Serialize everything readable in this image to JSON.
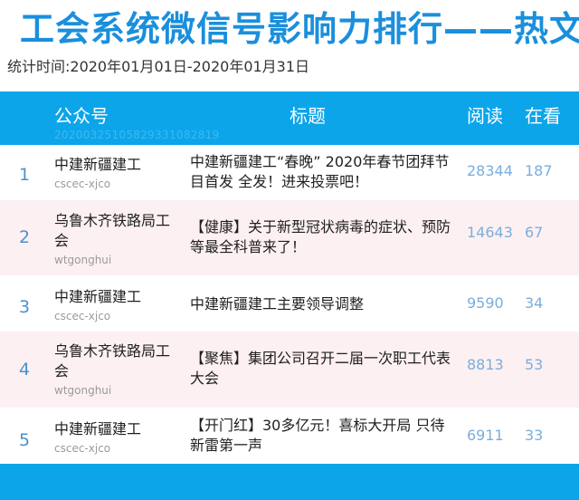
{
  "title": "工会系统微信号影响力排行——热文",
  "period": "统计时间:2020年01月01日-2020年01月31日",
  "table": {
    "headers": {
      "account": "公众号",
      "headline": "标题",
      "reads": "阅读",
      "watching": "在看"
    },
    "header_code": "20200325105829331082819",
    "rows": [
      {
        "rank": "1",
        "account": "中建新疆建工",
        "account_id": "cscec-xjco",
        "headline": "中建新疆建工“春晚” 2020年春节团拜节目首发 全发！进来投票吧！",
        "reads": "28344",
        "watching": "187"
      },
      {
        "rank": "2",
        "account": "乌鲁木齐铁路局工会",
        "account_id": "wtgonghui",
        "headline": "【健康】关于新型冠状病毒的症状、预防等最全科普来了！",
        "reads": "14643",
        "watching": "67"
      },
      {
        "rank": "3",
        "account": "中建新疆建工",
        "account_id": "cscec-xjco",
        "headline": "中建新疆建工主要领导调整",
        "reads": "9590",
        "watching": "34"
      },
      {
        "rank": "4",
        "account": "乌鲁木齐铁路局工会",
        "account_id": "wtgonghui",
        "headline": "【聚焦】集团公司召开二届一次职工代表大会",
        "reads": "8813",
        "watching": "53"
      },
      {
        "rank": "5",
        "account": "中建新疆建工",
        "account_id": "cscec-xjco",
        "headline": "【开门红】30多亿元！喜标大开局 只待新雷第一声",
        "reads": "6911",
        "watching": "33"
      }
    ]
  }
}
